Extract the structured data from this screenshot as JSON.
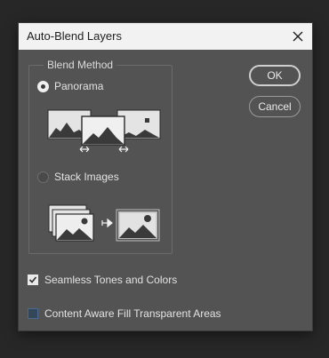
{
  "dialog": {
    "title": "Auto-Blend Layers",
    "close_icon": "close-icon"
  },
  "blend_method": {
    "legend": "Blend Method",
    "options": [
      {
        "label": "Panorama",
        "selected": true
      },
      {
        "label": "Stack Images",
        "selected": false
      }
    ]
  },
  "buttons": {
    "ok_label": "OK",
    "cancel_label": "Cancel"
  },
  "checkboxes": [
    {
      "label": "Seamless Tones and Colors",
      "checked": true
    },
    {
      "label": "Content Aware Fill Transparent Areas",
      "checked": false
    }
  ],
  "colors": {
    "dialog_bg": "#535353",
    "titlebar_bg": "#f2f2f2",
    "focus_checkbox": "#466a90"
  }
}
